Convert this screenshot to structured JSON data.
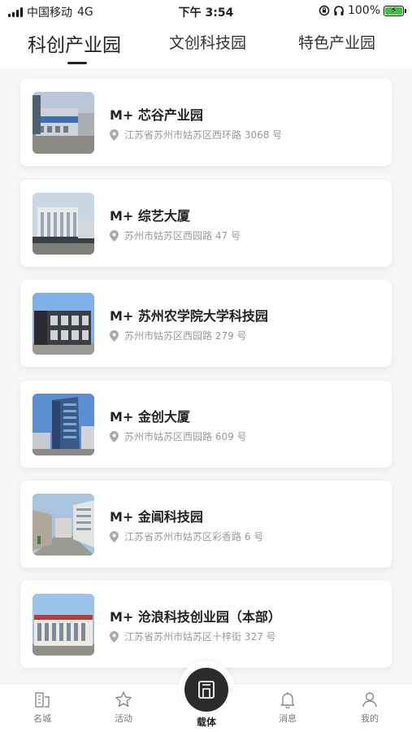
{
  "status_bar": {
    "carrier": "中国移动",
    "network": "4G",
    "time": "下午 3:54",
    "battery": "100%",
    "battery_level": 1.0
  },
  "tabs": [
    {
      "label": "科创产业园",
      "active": true
    },
    {
      "label": "文创科技园",
      "active": false
    },
    {
      "label": "特色产业园",
      "active": false
    }
  ],
  "parks": [
    {
      "name": "M+ 芯谷产业园",
      "address": "江苏省苏州市姑苏区西环路 3068 号"
    },
    {
      "name": "M+ 综艺大厦",
      "address": "苏州市姑苏区西园路 47 号"
    },
    {
      "name": "M+ 苏州农学院大学科技园",
      "address": "苏州市姑苏区西园路 279 号"
    },
    {
      "name": "M+ 金创大厦",
      "address": "苏州市姑苏区西园路 609 号"
    },
    {
      "name": "M+ 金阊科技园",
      "address": "江苏省苏州市姑苏区彩香路 6 号"
    },
    {
      "name": "M+ 沧浪科技创业园（本部）",
      "address": "江苏省苏州市姑苏区十梓街 327 号"
    }
  ],
  "bottom_nav": [
    {
      "label": "名城",
      "icon": "city-icon"
    },
    {
      "label": "活动",
      "icon": "star-icon"
    },
    {
      "label": "载体",
      "icon": "building-icon",
      "active": true
    },
    {
      "label": "消息",
      "icon": "bell-icon"
    },
    {
      "label": "我的",
      "icon": "user-icon"
    }
  ],
  "colors": {
    "accent": "#2b2b2b",
    "pin": "#999999",
    "battery": "#3cc43c"
  }
}
